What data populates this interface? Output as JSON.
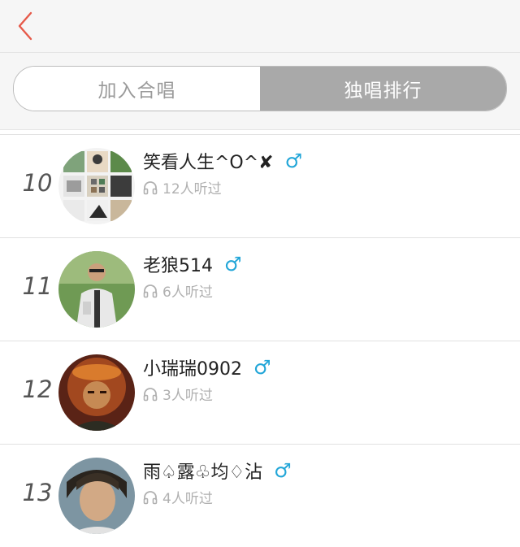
{
  "tabs": [
    {
      "label": "加入合唱",
      "active": false
    },
    {
      "label": "独唱排行",
      "active": true
    }
  ],
  "colors": {
    "accent": "#e65a4a",
    "male": "#22a6d8",
    "active_tab": "#a9a9a9"
  },
  "icons": {
    "back": "chevron-left-icon",
    "headphones": "headphones-icon",
    "gender": "male-icon"
  },
  "rows": [
    {
      "rank": "10",
      "name": "笑看人生^O^✘",
      "gender": "♂",
      "listens": "12人听过"
    },
    {
      "rank": "11",
      "name": "老狼514",
      "gender": "♂",
      "listens": "6人听过"
    },
    {
      "rank": "12",
      "name": "小瑞瑞0902",
      "gender": "♂",
      "listens": "3人听过"
    },
    {
      "rank": "13",
      "name": "雨♤露♧均♢沾",
      "gender": "♂",
      "listens": "4人听过"
    }
  ]
}
